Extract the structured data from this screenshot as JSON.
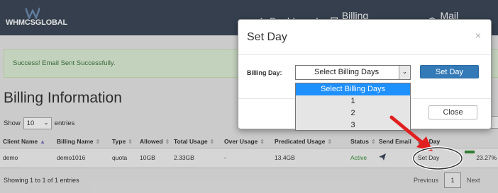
{
  "header": {
    "logo_text": "WHMCSGLOBAL",
    "nav": [
      {
        "label": "Dashboard",
        "icon": "home-icon"
      },
      {
        "label": "Billing Information",
        "icon": "building-icon"
      },
      {
        "label": "Mail Template",
        "icon": "mail-template-icon"
      }
    ]
  },
  "alert": {
    "message": "Success! Email Sent Successfully."
  },
  "page": {
    "title": "Billing Information"
  },
  "table_controls": {
    "show_label": "Show",
    "show_value": "10",
    "entries_label": "entries"
  },
  "table": {
    "columns": [
      "Client Name",
      "Billing Name",
      "Type",
      "Allowed",
      "Total Usage",
      "Over Usage",
      "Predicated Usage",
      "Status",
      "Send Email",
      "Set Day",
      ""
    ],
    "rows": [
      {
        "client_name": "demo",
        "billing_name": "demo1016",
        "type": "quota",
        "allowed": "10GB",
        "total_usage": "2.33GB",
        "over_usage": "-",
        "predicated_usage": "13.4GB",
        "status": "Active",
        "set_day": "Set Day",
        "percent": "23.27%"
      }
    ]
  },
  "footer": {
    "info": "Showing 1 to 1 of 1 entries",
    "previous": "Previous",
    "page": "1",
    "next": "Next"
  },
  "modal": {
    "title": "Set Day",
    "close_symbol": "×",
    "billing_day_label": "Billing Day:",
    "select_value": "Select Billing Days",
    "set_day_button": "Set Day",
    "close_button": "Close",
    "options": [
      "Select Billing Days",
      "1",
      "2",
      "3"
    ]
  },
  "colors": {
    "header_bg": "#3d4859",
    "primary_button": "#337ab7",
    "alert_bg": "#dff0d8",
    "status_active": "#3a8f3a",
    "annotation_red": "#e02020",
    "dropdown_highlight": "#1e90ff"
  }
}
